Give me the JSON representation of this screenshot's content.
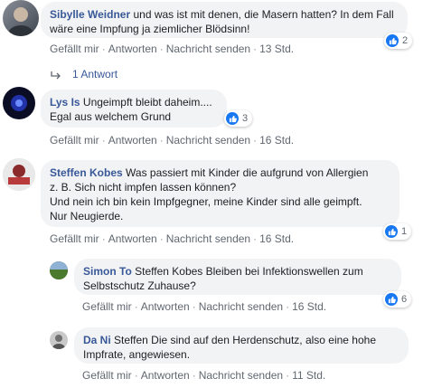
{
  "actions": {
    "like": "Gefällt mir",
    "reply": "Antworten",
    "message": "Nachricht senden",
    "sep": "·"
  },
  "comments": [
    {
      "author": "Sibylle Weidner",
      "text": "und was ist mit denen, die Masern hatten? In dem Fall wäre eine Impfung ja ziemlicher Blödsinn!",
      "likes": "2",
      "time": "13 Std."
    },
    {
      "author": "Lys Is",
      "text_line1": "Ungeimpft bleibt daheim....",
      "text_line2": "Egal aus welchem Grund",
      "likes": "3",
      "time": "16 Std."
    },
    {
      "author": "Steffen Kobes",
      "text_line1": "Was passiert mit Kinder die aufgrund von Allergien",
      "text_line2": "z. B. Sich nicht impfen lassen können?",
      "text_line3": "Und nein ich bin kein Impfgegner, meine Kinder sind alle geimpft.",
      "text_line4": "Nur Neugierde.",
      "likes": "1",
      "time": "16 Std."
    },
    {
      "author": "Simon To",
      "text_line1": "Steffen Kobes Bleiben bei Infektionswellen zum",
      "text_line2": "Selbstschutz Zuhause?",
      "likes": "6",
      "time": "16 Std."
    },
    {
      "author": "Da Ni",
      "text_line1": "Steffen Die sind auf den Herdenschutz, also eine hohe",
      "text_line2": "Impfrate, angewiesen.",
      "time": "11 Std."
    }
  ],
  "replies_toggle": "1 Antwort",
  "colors": {
    "name": "#385898",
    "bubble": "#f2f3f5",
    "like": "#1877f2",
    "meta": "#606770"
  }
}
